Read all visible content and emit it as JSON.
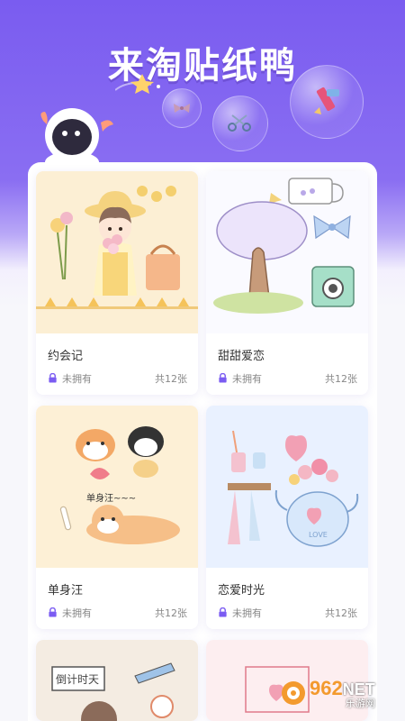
{
  "banner": {
    "title": "来淘贴纸鸭"
  },
  "cards": [
    {
      "name": "约会记",
      "status": "未拥有",
      "count": "共12张"
    },
    {
      "name": "甜甜爱恋",
      "status": "未拥有",
      "count": "共12张"
    },
    {
      "name": "单身汪",
      "status": "未拥有",
      "count": "共12张"
    },
    {
      "name": "恋爱时光",
      "status": "未拥有",
      "count": "共12张"
    },
    {
      "name": "",
      "status": "",
      "count": ""
    },
    {
      "name": "",
      "status": "",
      "count": ""
    }
  ],
  "stickers": {
    "countdown_text": "倒计时天",
    "dog_text": "单身汪~~~",
    "pot_text": "LOVE"
  },
  "watermark": {
    "logo_number": "962",
    "logo_suffix": "NET",
    "logo_text": "乐游网"
  },
  "colors": {
    "brand": "#7a5cf0",
    "lock": "#7b5cf2"
  }
}
